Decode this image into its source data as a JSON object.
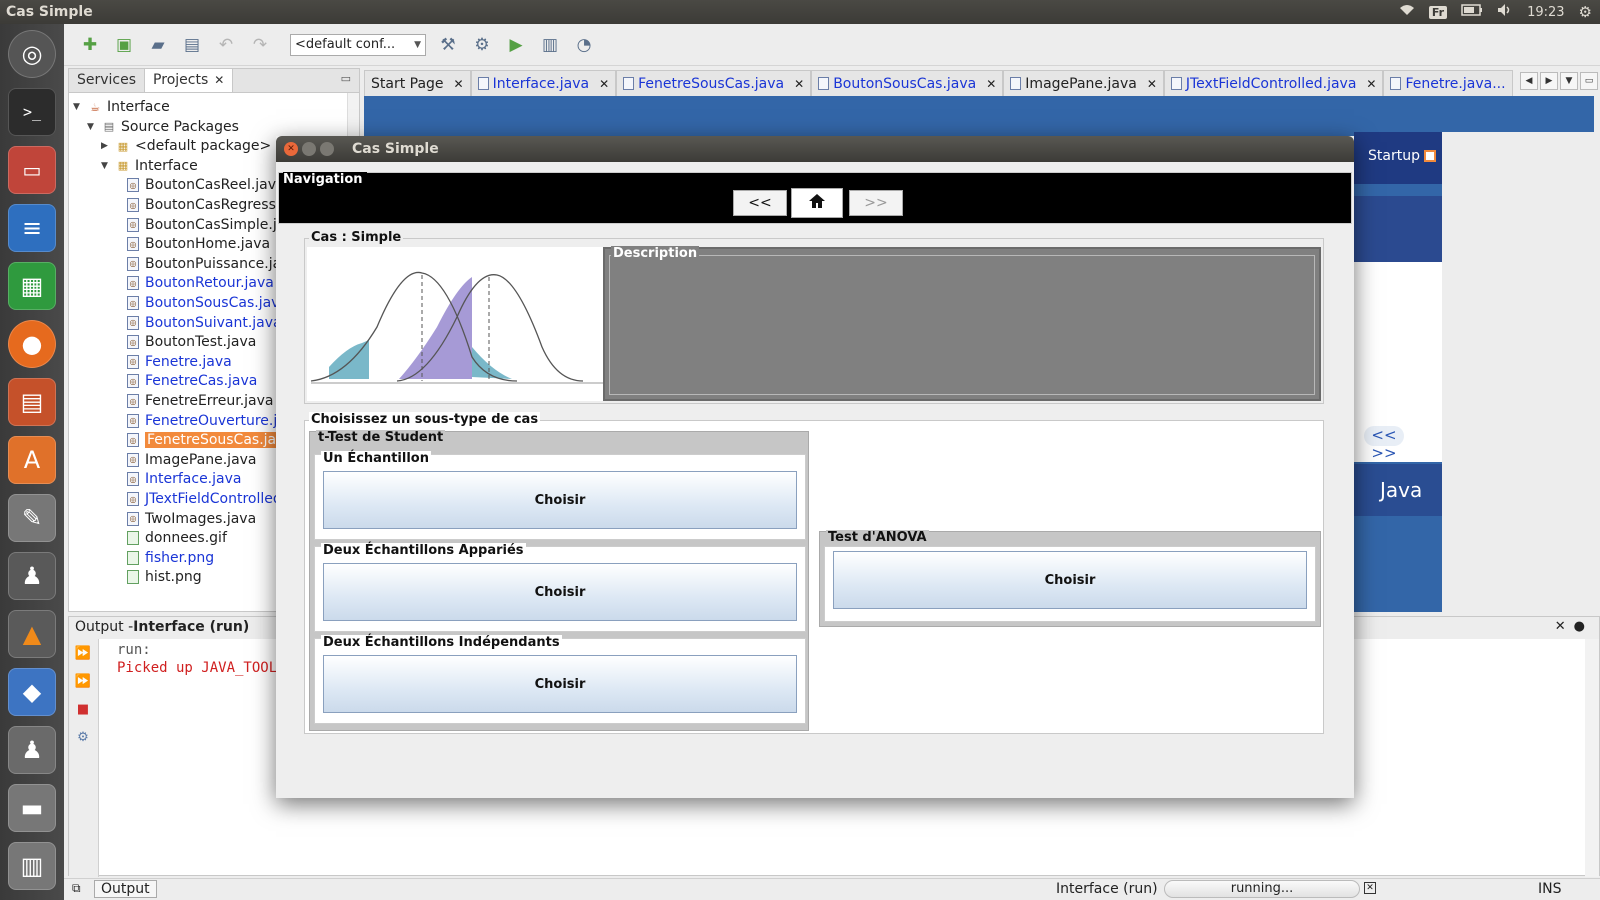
{
  "topbar": {
    "title": "Cas Simple",
    "keyboard": "Fr",
    "time": "19:23"
  },
  "toolbar": {
    "config": "<default conf..."
  },
  "projects": {
    "tabs": [
      {
        "label": "Services"
      },
      {
        "label": "Projects"
      }
    ],
    "tree": [
      {
        "label": "Interface",
        "level": 0,
        "tri": "▼",
        "icon": "project"
      },
      {
        "label": "Source Packages",
        "level": 1,
        "tri": "▼",
        "icon": "source"
      },
      {
        "label": "<default package>",
        "level": 2,
        "tri": "▶",
        "icon": "package"
      },
      {
        "label": "Interface",
        "level": 2,
        "tri": "▼",
        "icon": "package"
      },
      {
        "label": "BoutonCasReel.java",
        "level": 3,
        "icon": "java"
      },
      {
        "label": "BoutonCasRegression.java",
        "level": 3,
        "icon": "java"
      },
      {
        "label": "BoutonCasSimple.java",
        "level": 3,
        "icon": "java"
      },
      {
        "label": "BoutonHome.java",
        "level": 3,
        "icon": "java"
      },
      {
        "label": "BoutonPuissance.java",
        "level": 3,
        "icon": "java"
      },
      {
        "label": "BoutonRetour.java",
        "level": 3,
        "icon": "java",
        "blue": true
      },
      {
        "label": "BoutonSousCas.java",
        "level": 3,
        "icon": "java",
        "blue": true
      },
      {
        "label": "BoutonSuivant.java",
        "level": 3,
        "icon": "java",
        "blue": true
      },
      {
        "label": "BoutonTest.java",
        "level": 3,
        "icon": "java"
      },
      {
        "label": "Fenetre.java",
        "level": 3,
        "icon": "java",
        "blue": true
      },
      {
        "label": "FenetreCas.java",
        "level": 3,
        "icon": "java",
        "blue": true
      },
      {
        "label": "FenetreErreur.java",
        "level": 3,
        "icon": "java"
      },
      {
        "label": "FenetreOuverture.java",
        "level": 3,
        "icon": "java",
        "blue": true
      },
      {
        "label": "FenetreSousCas.java",
        "level": 3,
        "icon": "java",
        "selected": true
      },
      {
        "label": "ImagePane.java",
        "level": 3,
        "icon": "java"
      },
      {
        "label": "Interface.java",
        "level": 3,
        "icon": "java",
        "blue": true
      },
      {
        "label": "JTextFieldControlled.java",
        "level": 3,
        "icon": "java",
        "blue": true
      },
      {
        "label": "TwoImages.java",
        "level": 3,
        "icon": "java"
      },
      {
        "label": "donnees.gif",
        "level": 3,
        "icon": "image"
      },
      {
        "label": "fisher.png",
        "level": 3,
        "icon": "image",
        "blue": true
      },
      {
        "label": "hist.png",
        "level": 3,
        "icon": "image"
      }
    ]
  },
  "editor_tabs": [
    {
      "label": "Start Page",
      "icon": false,
      "blue": false
    },
    {
      "label": "Interface.java",
      "icon": true,
      "blue": true
    },
    {
      "label": "FenetreSousCas.java",
      "icon": true,
      "blue": true
    },
    {
      "label": "BoutonSousCas.java",
      "icon": true,
      "blue": true
    },
    {
      "label": "ImagePane.java",
      "icon": true,
      "blue": false
    },
    {
      "label": "JTextFieldControlled.java",
      "icon": true,
      "blue": true
    },
    {
      "label": "Fenetre.java...",
      "icon": true,
      "blue": true
    }
  ],
  "start_page": {
    "startup_label": "Startup",
    "more": "<<  >>",
    "java_logo": "Java"
  },
  "output": {
    "title_prefix": "Output - ",
    "title_name": "Interface (run)",
    "lines": [
      {
        "text": "run:",
        "kind": "run"
      },
      {
        "text": "Picked up JAVA_TOOL_OPTIONS",
        "kind": "err"
      }
    ]
  },
  "status": {
    "output_tab": "Output",
    "process": "Interface (run)",
    "progress": "running...",
    "mode": "INS"
  },
  "dialog": {
    "title": "Cas Simple",
    "navigation": {
      "legend": "Navigation",
      "back": "<<",
      "forward": ">>"
    },
    "cas": {
      "legend": "Cas : Simple",
      "description_legend": "Description"
    },
    "sous_type": {
      "legend": "Choisissez un sous-type de cas",
      "student": {
        "legend": "t-Test de Student",
        "options": [
          {
            "legend": "Un Échantillon",
            "button": "Choisir"
          },
          {
            "legend": "Deux Échantillons Appariés",
            "button": "Choisir"
          },
          {
            "legend": "Deux Échantillons Indépendants",
            "button": "Choisir"
          }
        ]
      },
      "anova": {
        "legend": "Test d'ANOVA",
        "button": "Choisir"
      }
    }
  }
}
